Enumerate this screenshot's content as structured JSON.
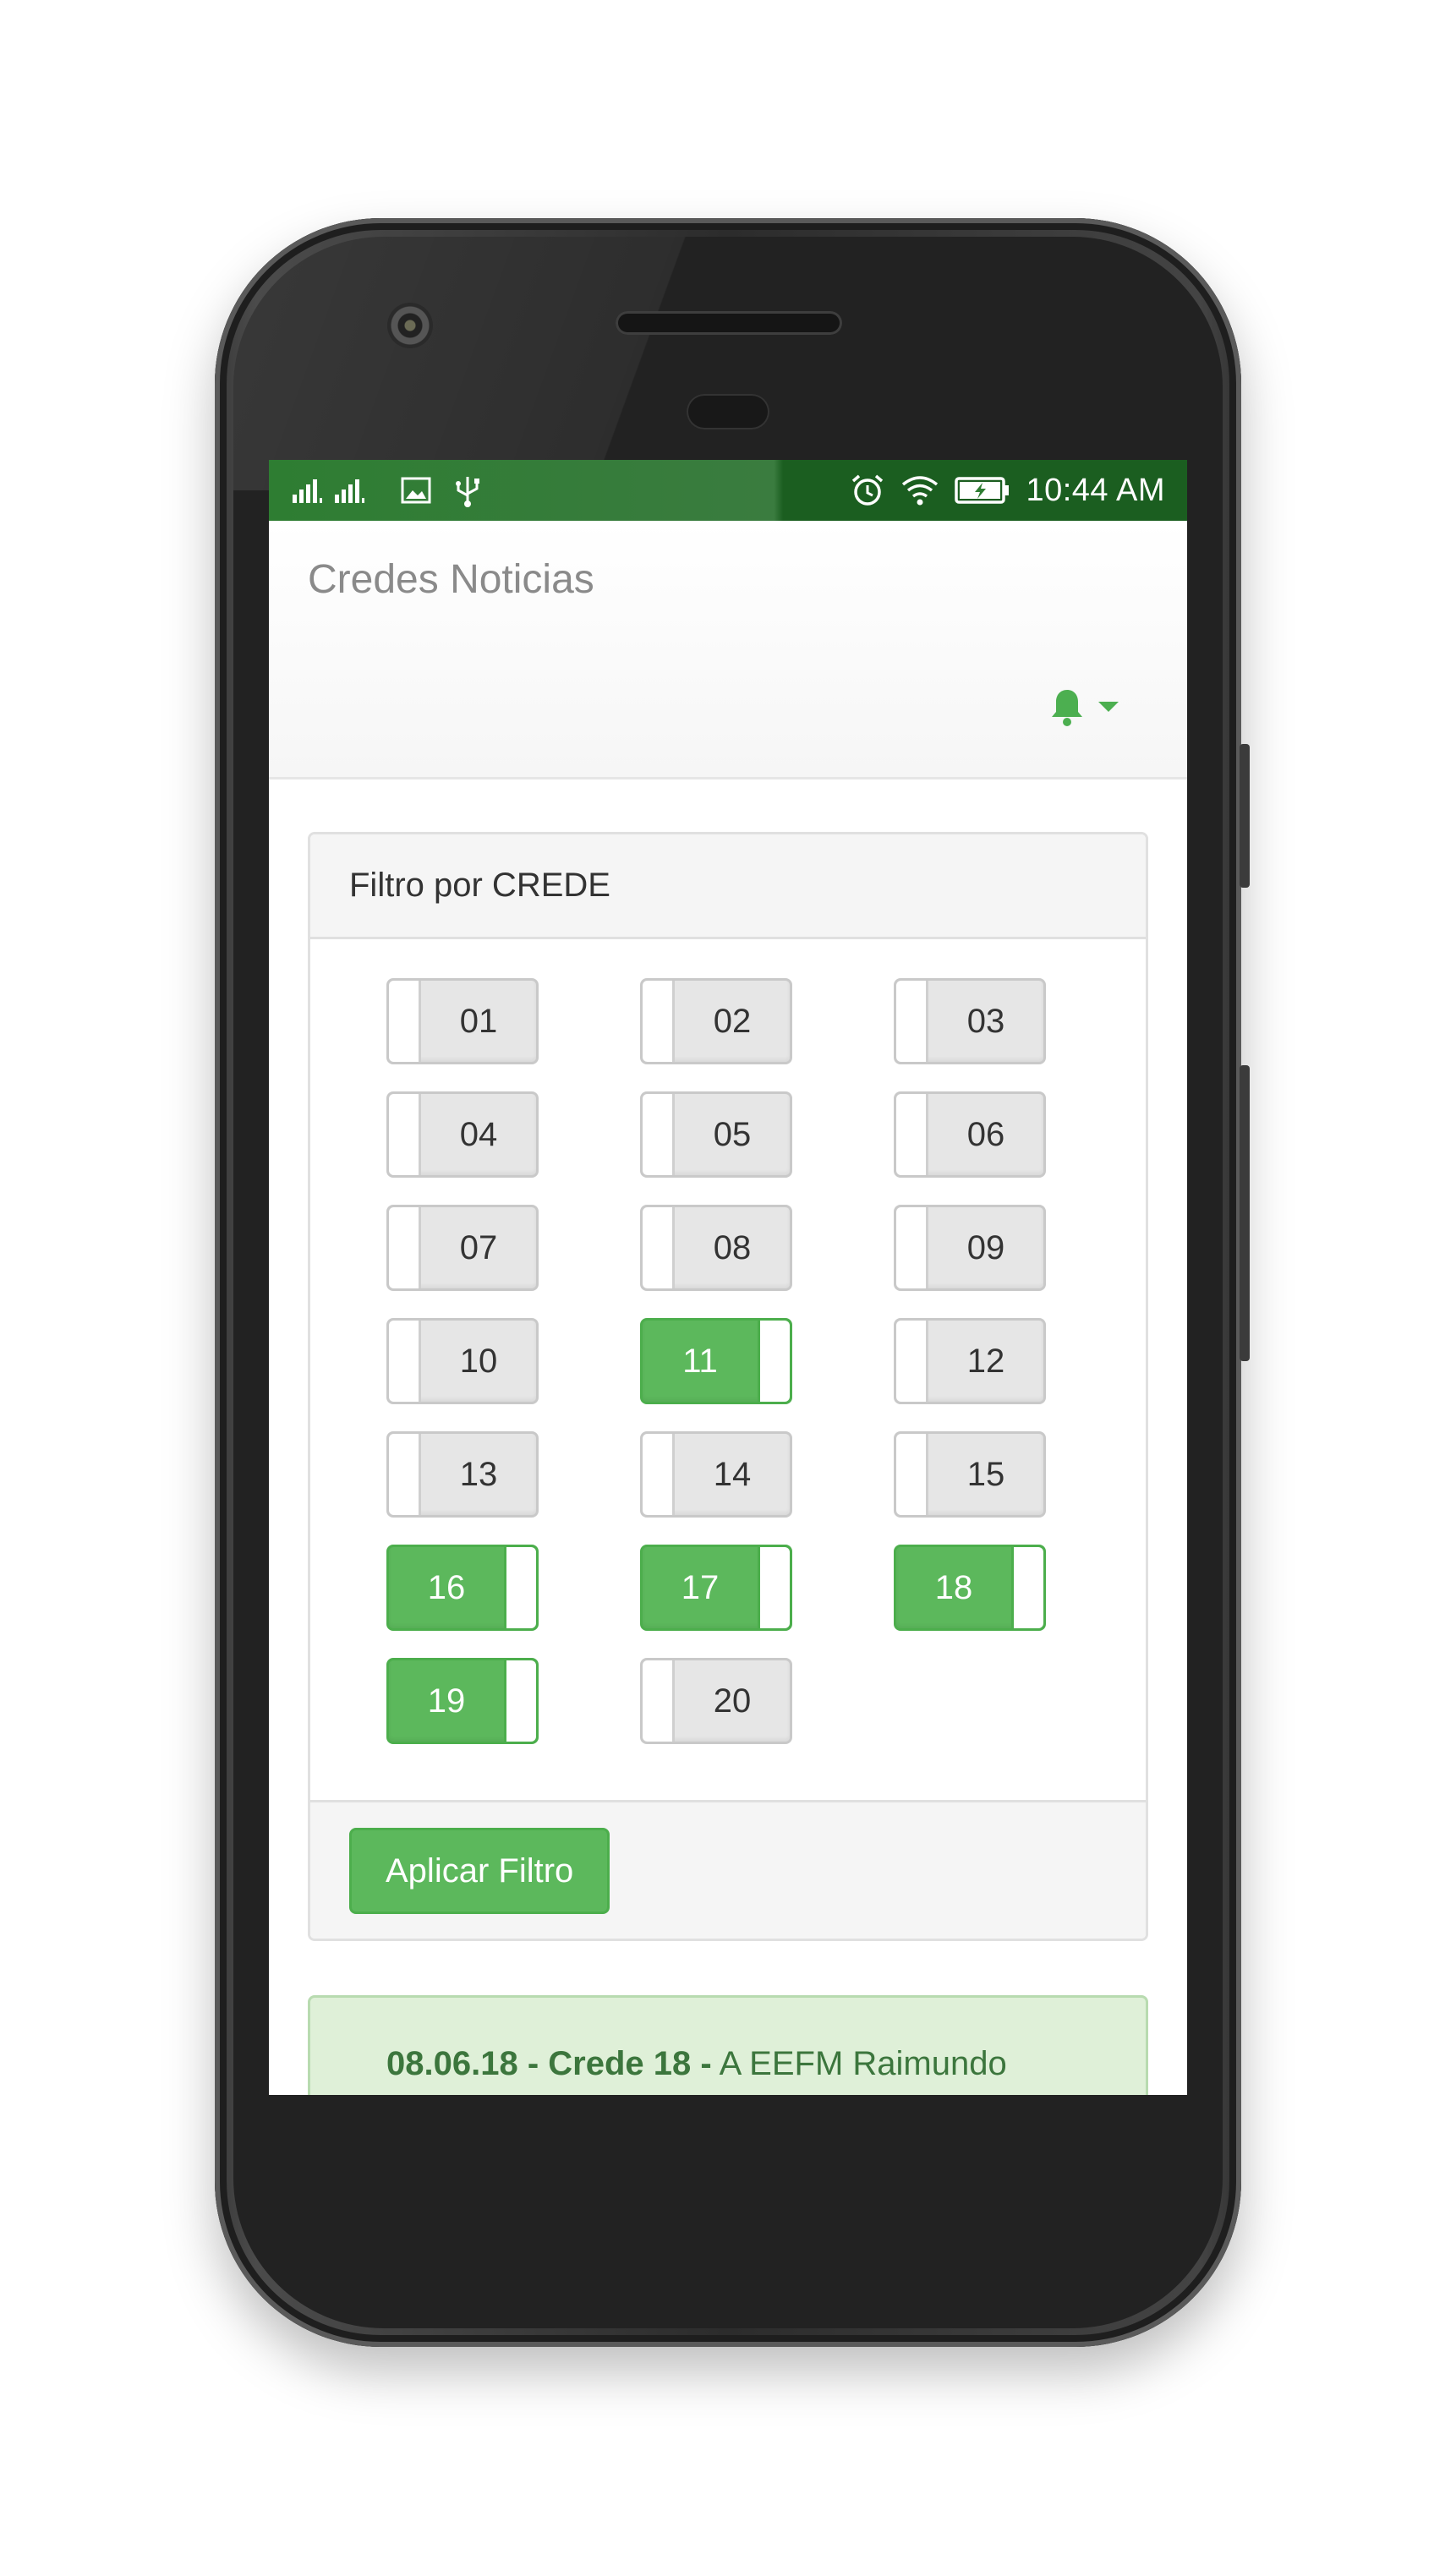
{
  "status_bar": {
    "time": "10:44 AM",
    "left_icons": [
      "signal-icon",
      "image-icon",
      "usb-icon"
    ],
    "right_icons": [
      "alarm-icon",
      "wifi-icon",
      "battery-charging-icon"
    ]
  },
  "app": {
    "title": "Credes Noticias",
    "notification_icon": "bell-icon"
  },
  "filter": {
    "header": "Filtro por CREDE",
    "toggles": [
      {
        "label": "01",
        "on": false
      },
      {
        "label": "02",
        "on": false
      },
      {
        "label": "03",
        "on": false
      },
      {
        "label": "04",
        "on": false
      },
      {
        "label": "05",
        "on": false
      },
      {
        "label": "06",
        "on": false
      },
      {
        "label": "07",
        "on": false
      },
      {
        "label": "08",
        "on": false
      },
      {
        "label": "09",
        "on": false
      },
      {
        "label": "10",
        "on": false
      },
      {
        "label": "11",
        "on": true
      },
      {
        "label": "12",
        "on": false
      },
      {
        "label": "13",
        "on": false
      },
      {
        "label": "14",
        "on": false
      },
      {
        "label": "15",
        "on": false
      },
      {
        "label": "16",
        "on": true
      },
      {
        "label": "17",
        "on": true
      },
      {
        "label": "18",
        "on": true
      },
      {
        "label": "19",
        "on": true
      },
      {
        "label": "20",
        "on": false
      }
    ],
    "apply_label": "Aplicar Filtro"
  },
  "news": {
    "headline_bold": "08.06.18 - Crede 18 -",
    "headline_text": " A EEFM Raimundo"
  },
  "colors": {
    "primary_green": "#5cb85c",
    "status_bar_green": "#2e7d32",
    "alert_bg": "#dff0d8",
    "alert_text": "#3c763d"
  }
}
